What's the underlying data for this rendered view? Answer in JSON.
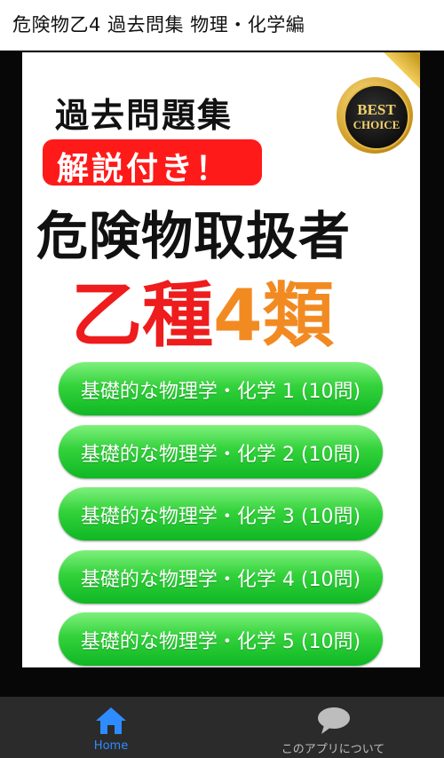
{
  "app": {
    "title": "危険物乙4 過去問集 物理・化学編"
  },
  "banner": {
    "subtitle": "過去問題集",
    "tag": "解説付き！",
    "headline": "危険物取扱者",
    "kind_part1": "乙種",
    "kind_part2": "4類",
    "badge_line1": "BEST",
    "badge_line2": "CHOICE"
  },
  "buttons": [
    {
      "label": "基礎的な物理学・化学 1 (10問)"
    },
    {
      "label": "基礎的な物理学・化学 2 (10問)"
    },
    {
      "label": "基礎的な物理学・化学 3 (10問)"
    },
    {
      "label": "基礎的な物理学・化学 4 (10問)"
    },
    {
      "label": "基礎的な物理学・化学 5 (10問)"
    }
  ],
  "nav": {
    "items": [
      {
        "label": "Home",
        "icon": "home-icon",
        "active": true
      },
      {
        "label": "このアプリについて",
        "icon": "chat-bubble-icon",
        "active": false
      }
    ]
  },
  "colors": {
    "accent": "#2f8cff",
    "red": "#ee1c1c",
    "orange": "#f28a22",
    "green": "#1fc12f",
    "nav_bg": "#2b2b2b",
    "inactive": "#bdbdbd"
  }
}
